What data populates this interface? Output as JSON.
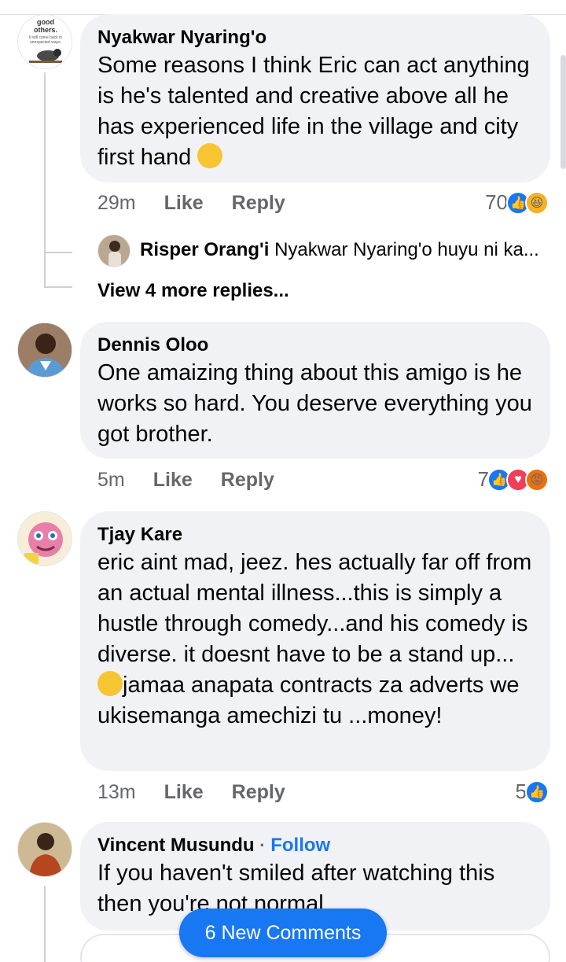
{
  "comments": [
    {
      "author": "Nyakwar Nyaring'o",
      "text": "Some reasons I think Eric can act anything is he's talented and creative above all he has experienced life in the village and city first hand",
      "time": "29m",
      "like_label": "Like",
      "reply_label": "Reply",
      "reaction_count": "70",
      "avatar_text": [
        "good",
        "others.",
        "It will come back in",
        "unexpected ways."
      ]
    },
    {
      "author": "Dennis Oloo",
      "text": "One amaizing thing about this amigo is he works so hard. You deserve everything you got brother.",
      "time": "5m",
      "like_label": "Like",
      "reply_label": "Reply",
      "reaction_count": "7"
    },
    {
      "author": "Tjay Kare",
      "text": "eric aint mad, jeez. hes actually far off from  an actual mental illness...this is simply a hustle through comedy...and his comedy is diverse. it doesnt have to be a stand up...",
      "text2": "jamaa anapata contracts za adverts we ukisemanga amechizi tu ...money!",
      "time": "13m",
      "like_label": "Like",
      "reply_label": "Reply",
      "reaction_count": "5"
    },
    {
      "author": "Vincent Musundu",
      "follow_label": "Follow",
      "separator": "·",
      "text": "If you haven't smiled after watching this then you're not normal"
    }
  ],
  "reply_preview": {
    "author": "Risper Orang'i",
    "text": "Nyakwar Nyaring'o huyu ni ka..."
  },
  "view_more": "View 4 more replies...",
  "new_comments_label": "6 New Comments",
  "colors": {
    "accent": "#1877f2",
    "bubble": "#f0f2f5",
    "meta": "#65676b"
  }
}
